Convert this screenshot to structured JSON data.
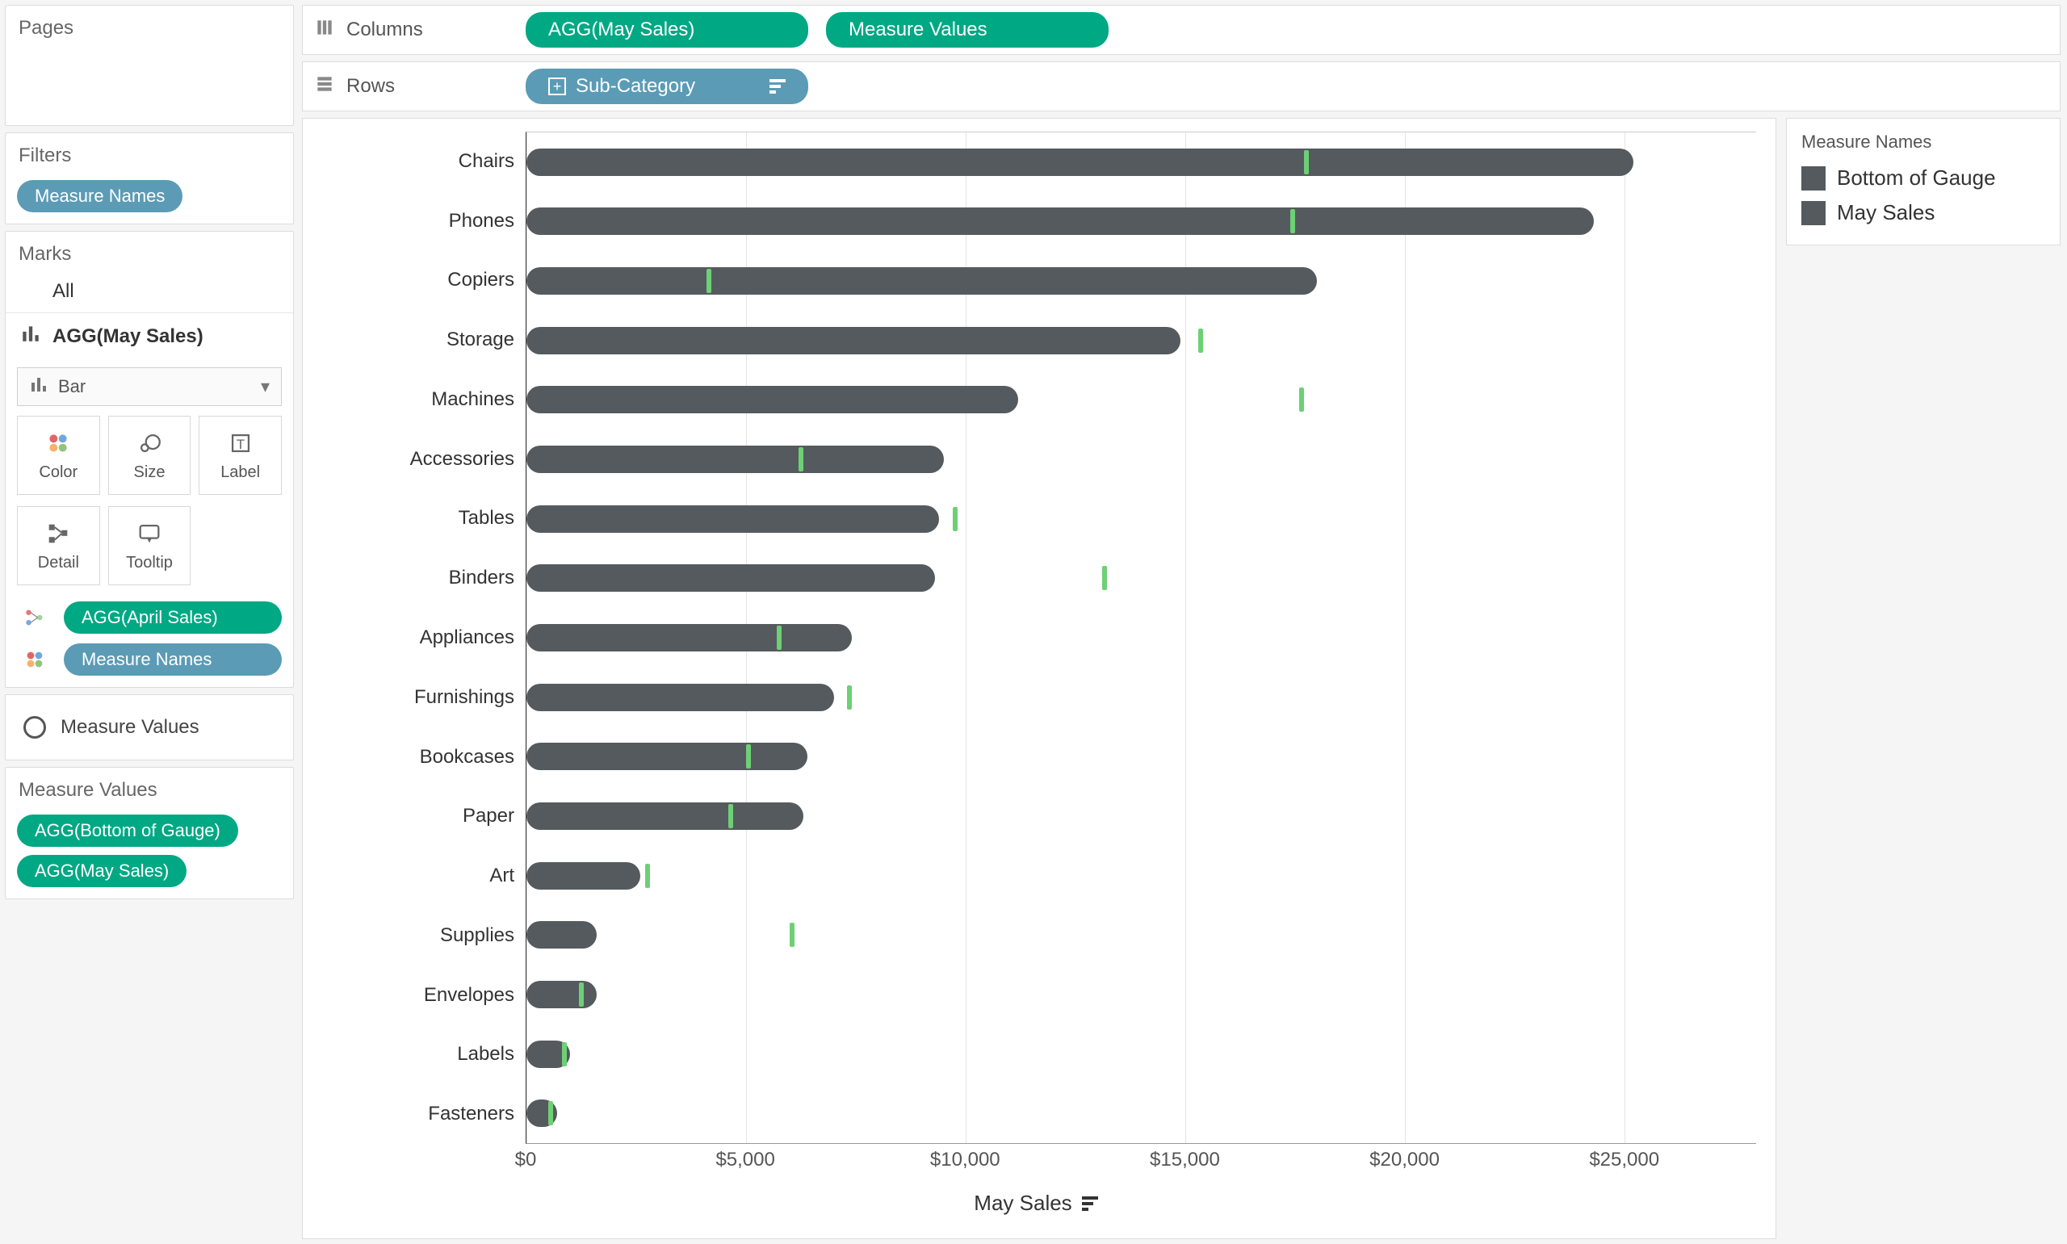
{
  "shelves": {
    "columns_label": "Columns",
    "rows_label": "Rows",
    "columns_pills": [
      "AGG(May Sales)",
      "Measure Values"
    ],
    "rows_pill": "Sub-Category"
  },
  "pages": {
    "title": "Pages"
  },
  "filters": {
    "title": "Filters",
    "pill": "Measure Names"
  },
  "marks": {
    "title": "Marks",
    "all": "All",
    "selected": "AGG(May Sales)",
    "type_label": "Bar",
    "cards": {
      "color": "Color",
      "size": "Size",
      "label": "Label",
      "detail": "Detail",
      "tooltip": "Tooltip"
    },
    "drops": [
      {
        "label": "AGG(April Sales)",
        "color": "green",
        "icon": "detail"
      },
      {
        "label": "Measure Names",
        "color": "blue",
        "icon": "color"
      }
    ],
    "measure_values_row": "Measure Values"
  },
  "measure_values_card": {
    "title": "Measure Values",
    "pills": [
      "AGG(Bottom of Gauge)",
      "AGG(May Sales)"
    ]
  },
  "legend": {
    "title": "Measure Names",
    "items": [
      "Bottom of Gauge",
      "May Sales"
    ]
  },
  "axis": {
    "title": "May Sales",
    "ticks": [
      "$0",
      "$5,000",
      "$10,000",
      "$15,000",
      "$20,000",
      "$25,000"
    ],
    "tick_values": [
      0,
      5000,
      10000,
      15000,
      20000,
      25000
    ],
    "max": 28000
  },
  "chart_data": {
    "type": "bar",
    "xlabel": "May Sales",
    "ylabel": "Sub-Category",
    "xlim": [
      0,
      28000
    ],
    "x_ticks": [
      0,
      5000,
      10000,
      15000,
      20000,
      25000
    ],
    "x_tick_labels": [
      "$0",
      "$5,000",
      "$10,000",
      "$15,000",
      "$20,000",
      "$25,000"
    ],
    "categories": [
      "Chairs",
      "Phones",
      "Copiers",
      "Storage",
      "Machines",
      "Accessories",
      "Tables",
      "Binders",
      "Appliances",
      "Furnishings",
      "Bookcases",
      "Paper",
      "Art",
      "Supplies",
      "Envelopes",
      "Labels",
      "Fasteners"
    ],
    "series": [
      {
        "name": "May Sales",
        "render": "bar",
        "color": "#555a5e",
        "values": [
          25200,
          24300,
          18000,
          14900,
          11200,
          9500,
          9400,
          9300,
          7400,
          7000,
          6400,
          6300,
          2600,
          1600,
          1600,
          1000,
          700
        ]
      },
      {
        "name": "April Sales",
        "render": "tick",
        "color": "#6dd075",
        "values": [
          17700,
          17400,
          4100,
          15300,
          17600,
          6200,
          9700,
          13100,
          5700,
          7300,
          5000,
          4600,
          2700,
          6000,
          1200,
          800,
          500
        ]
      }
    ],
    "legend": [
      "Bottom of Gauge",
      "May Sales"
    ]
  }
}
